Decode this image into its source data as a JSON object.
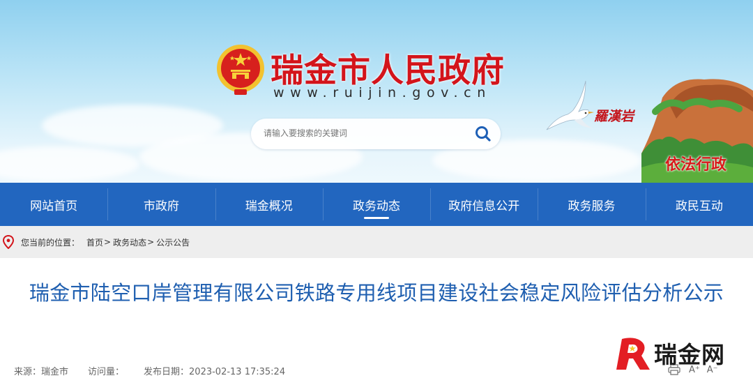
{
  "header": {
    "site_title": "瑞金市人民政府",
    "site_url": "www.ruijin.gov.cn",
    "search_placeholder": "请输入要搜索的关键词",
    "scenic_label": "羅漢岩",
    "slogan": "依法行政",
    "emblem_icon": "national-emblem-icon",
    "search_icon": "search-icon"
  },
  "nav": {
    "items": [
      {
        "label": "网站首页",
        "active": false
      },
      {
        "label": "市政府",
        "active": false
      },
      {
        "label": "瑞金概况",
        "active": false
      },
      {
        "label": "政务动态",
        "active": true
      },
      {
        "label": "政府信息公开",
        "active": false
      },
      {
        "label": "政务服务",
        "active": false
      },
      {
        "label": "政民互动",
        "active": false
      }
    ]
  },
  "breadcrumb": {
    "prefix": "您当前的位置：",
    "items": [
      "首页",
      "政务动态",
      "公示公告"
    ],
    "separator": ">"
  },
  "article": {
    "title": "瑞金市陆空口岸管理有限公司铁路专用线项目建设社会稳定风险评估分析公示",
    "source": "来源：瑞金市",
    "visits": "访问量：",
    "publish_date": "发布日期：2023-02-13 17:35:24"
  },
  "tools": {
    "font_larger": "A⁺",
    "font_smaller": "A⁻",
    "print_icon": "print-icon"
  },
  "watermark": {
    "text": "瑞金网"
  },
  "colors": {
    "nav_bg": "#2266bf",
    "title_red": "#d3141b",
    "article_title": "#1f5fb0",
    "breadcrumb_bg": "#eeeeee"
  }
}
